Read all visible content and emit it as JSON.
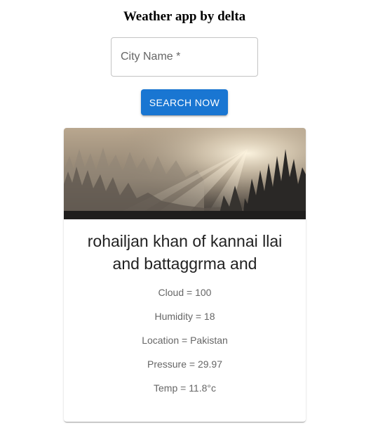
{
  "app": {
    "title": "Weather app by delta"
  },
  "search": {
    "city_placeholder": "City Name *",
    "city_value": "",
    "button_label": "SEARCH NOW"
  },
  "card": {
    "image_icon": "foggy-forest-image",
    "heading": "rohailjan khan of kannai llai and battaggrma and",
    "cloud": "Cloud = 100",
    "humidity": "Humidity = 18",
    "location": "Location = Pakistan",
    "pressure": "Pressure = 29.97",
    "temp": "Temp = 11.8°c"
  },
  "colors": {
    "accent": "#1976d2"
  }
}
